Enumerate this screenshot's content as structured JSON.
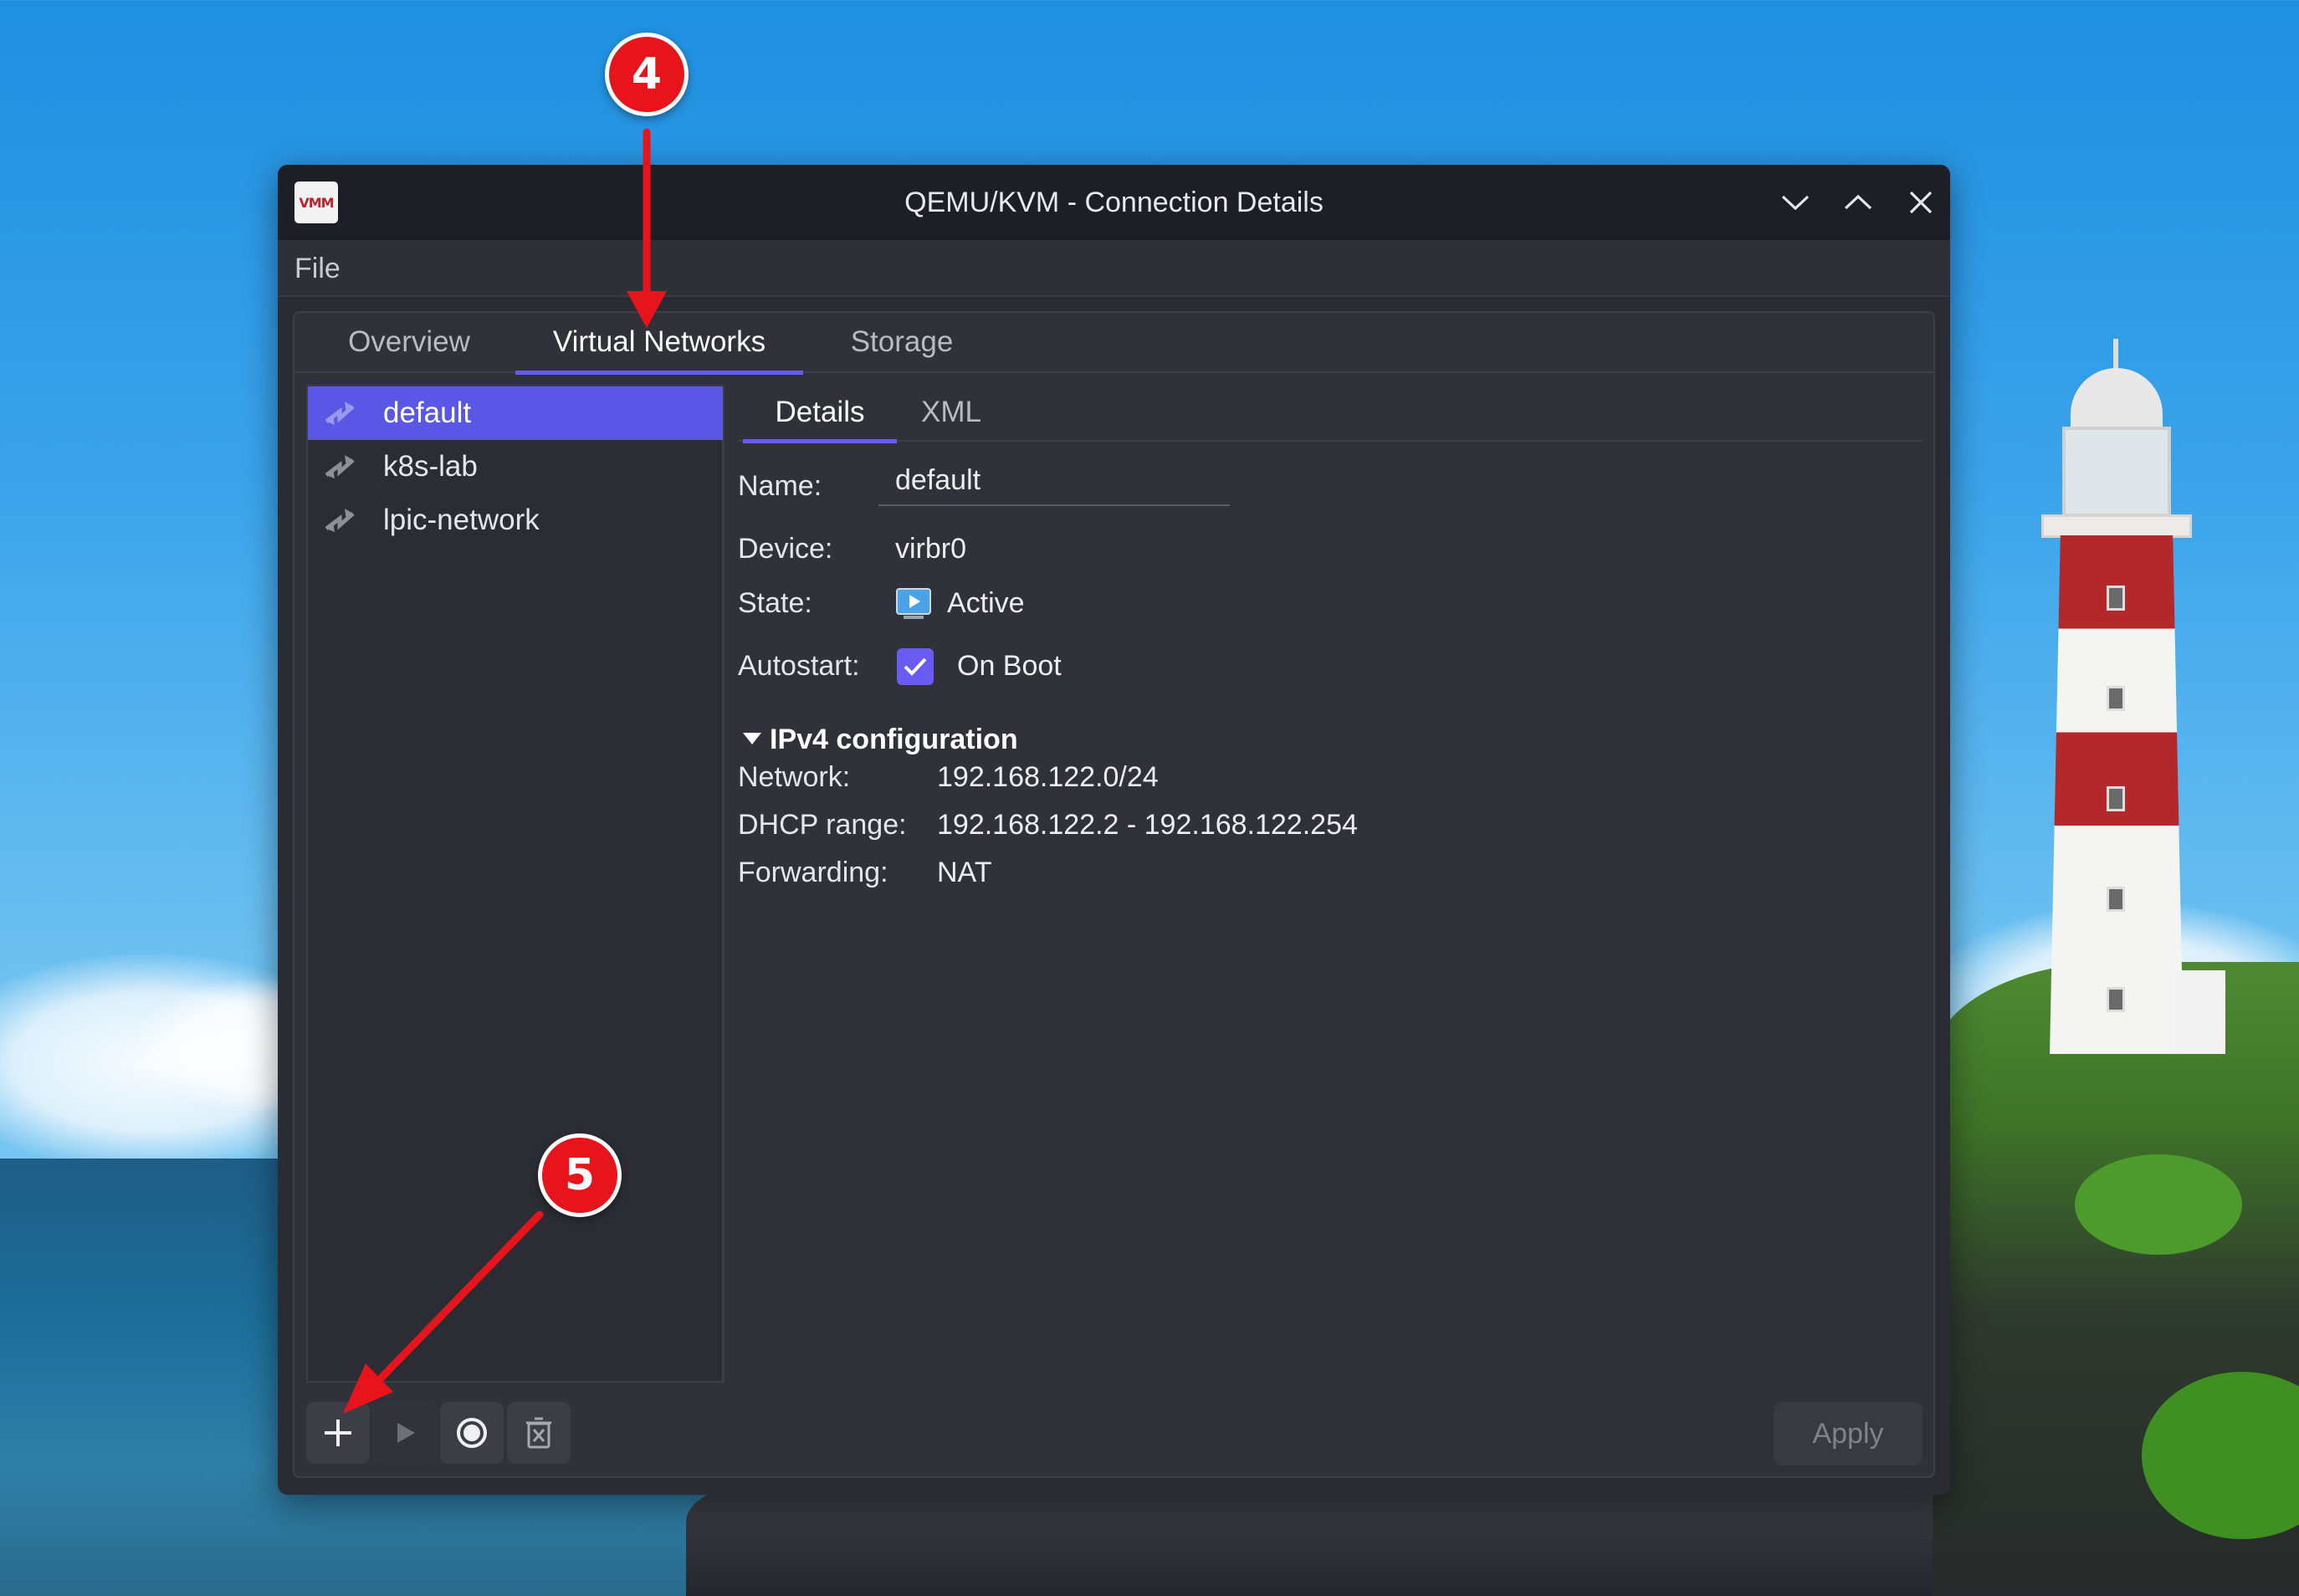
{
  "window": {
    "title": "QEMU/KVM - Connection Details",
    "app_icon_text": "VMM"
  },
  "menubar": {
    "file": "File"
  },
  "tabs": [
    {
      "label": "Overview"
    },
    {
      "label": "Virtual Networks",
      "active": true
    },
    {
      "label": "Storage"
    }
  ],
  "networks": [
    {
      "name": "default",
      "selected": true
    },
    {
      "name": "k8s-lab"
    },
    {
      "name": "lpic-network"
    }
  ],
  "subtabs": [
    {
      "label": "Details",
      "active": true
    },
    {
      "label": "XML"
    }
  ],
  "details": {
    "name_label": "Name:",
    "name_value": "default",
    "device_label": "Device:",
    "device_value": "virbr0",
    "state_label": "State:",
    "state_value": "Active",
    "autostart_label": "Autostart:",
    "autostart_value": "On Boot",
    "autostart_checked": true
  },
  "ipv4": {
    "title": "IPv4 configuration",
    "network_label": "Network:",
    "network_value": "192.168.122.0/24",
    "dhcp_label": "DHCP range:",
    "dhcp_value": "192.168.122.2 - 192.168.122.254",
    "forwarding_label": "Forwarding:",
    "forwarding_value": "NAT"
  },
  "toolbar": {
    "add_icon": "plus-icon",
    "start_icon": "play-icon",
    "stop_icon": "stop-icon",
    "delete_icon": "delete-icon",
    "apply_label": "Apply"
  },
  "annotations": [
    {
      "number": "4"
    },
    {
      "number": "5"
    }
  ],
  "colors": {
    "accent": "#6a5cf2",
    "selection": "#5b57e6",
    "annotation_red": "#e8141b",
    "window_bg": "#2b2c33",
    "titlebar_bg": "#1d1e26"
  }
}
